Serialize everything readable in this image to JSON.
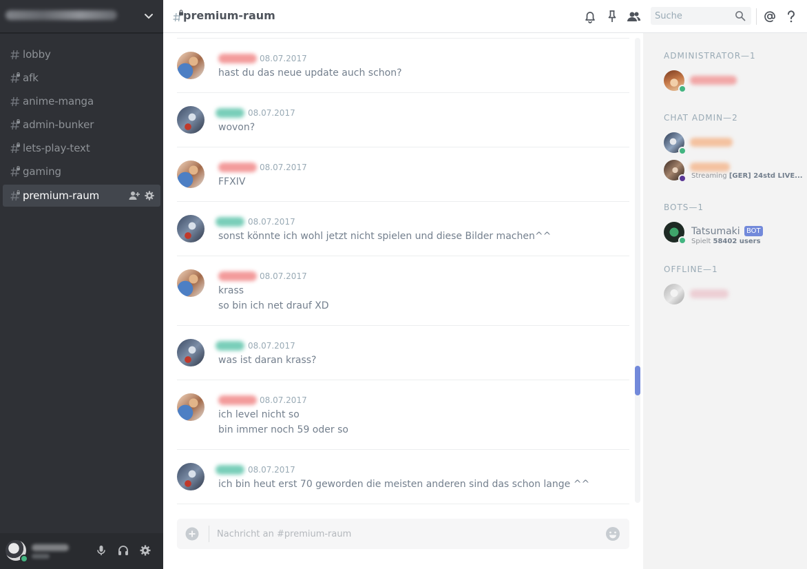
{
  "server": {
    "name_redacted": true
  },
  "channels": [
    {
      "label": "lobby",
      "locked": false,
      "selected": false
    },
    {
      "label": "afk",
      "locked": true,
      "selected": false
    },
    {
      "label": "anime-manga",
      "locked": false,
      "selected": false
    },
    {
      "label": "admin-bunker",
      "locked": true,
      "selected": false
    },
    {
      "label": "lets-play-text",
      "locked": true,
      "selected": false
    },
    {
      "label": "gaming",
      "locked": true,
      "selected": false
    },
    {
      "label": "premium-raum",
      "locked": true,
      "selected": true
    }
  ],
  "header": {
    "channel_title": "premium-raum",
    "search_placeholder": "Suche",
    "icons": [
      "bell-icon",
      "pin-icon",
      "members-icon",
      "search-icon",
      "mention-icon",
      "help-icon"
    ]
  },
  "messages": [
    {
      "author_color": "red",
      "time": "08.07.2017",
      "lines": [
        "hast du das neue update auch schon?"
      ]
    },
    {
      "author_color": "teal",
      "time": "08.07.2017",
      "lines": [
        "wovon?"
      ]
    },
    {
      "author_color": "red",
      "time": "08.07.2017",
      "lines": [
        "FFXIV"
      ]
    },
    {
      "author_color": "teal",
      "time": "08.07.2017",
      "lines": [
        "sonst könnte ich wohl jetzt nicht spielen und diese Bilder machen^^"
      ]
    },
    {
      "author_color": "red",
      "time": "08.07.2017",
      "lines": [
        "krass",
        "so bin ich net drauf XD"
      ]
    },
    {
      "author_color": "teal",
      "time": "08.07.2017",
      "lines": [
        "was ist daran krass?"
      ]
    },
    {
      "author_color": "red",
      "time": "08.07.2017",
      "lines": [
        "ich level nicht so",
        "bin immer noch 59 oder so"
      ]
    },
    {
      "author_color": "teal",
      "time": "08.07.2017",
      "lines": [
        "ich bin heut erst 70 geworden die meisten anderen sind das schon lange ^^"
      ]
    }
  ],
  "composer": {
    "placeholder": "Nachricht an #premium-raum"
  },
  "members": {
    "roles": [
      {
        "title": "ADMINISTRATOR—1"
      },
      {
        "title": "CHAT ADMIN—2"
      },
      {
        "title": "BOTS—1"
      },
      {
        "title": "OFFLINE—1"
      }
    ],
    "streaming": {
      "prefix": "Streaming",
      "activity": "[GER] 24std LIVE..."
    },
    "bot": {
      "name": "Tatsumaki",
      "tag": "BOT",
      "activity_prefix": "Spielt",
      "activity": "58402 users"
    }
  },
  "colors": {
    "accent": "#7289da",
    "online": "#43b581",
    "streaming": "#593695",
    "sidebar_bg": "#2f3136",
    "members_bg": "#f3f3f3"
  }
}
